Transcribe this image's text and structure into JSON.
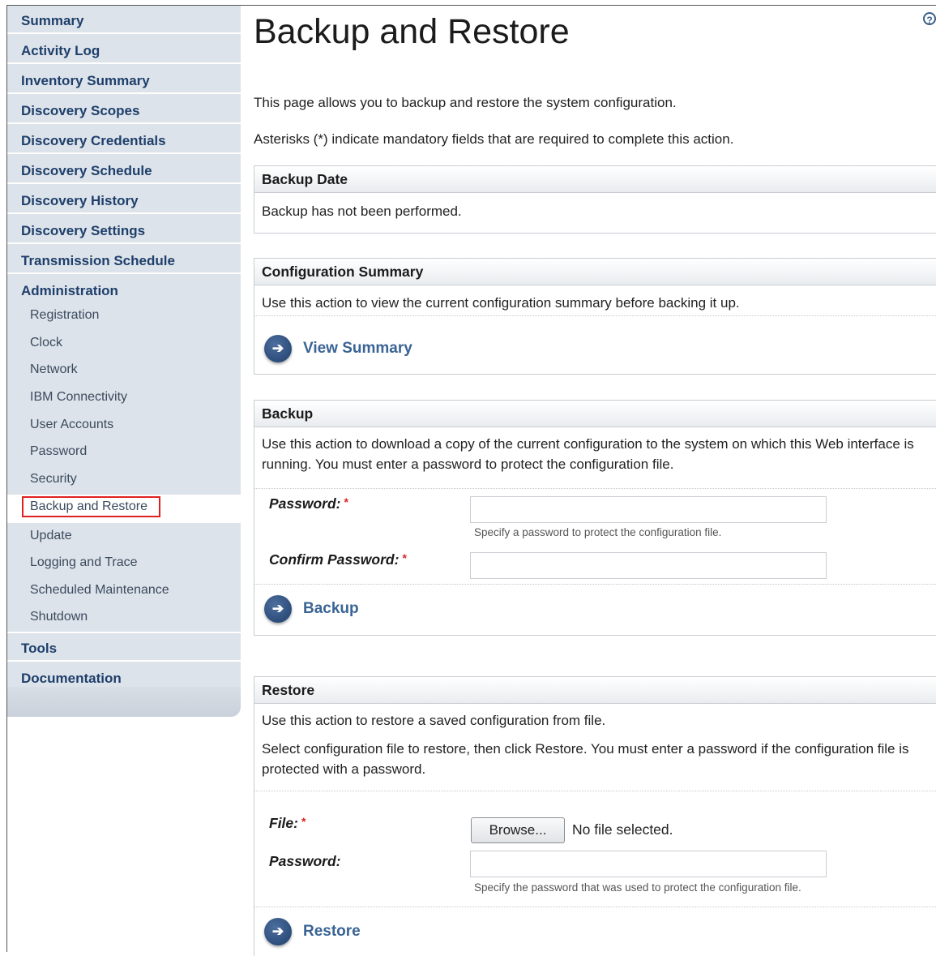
{
  "sidebar": {
    "top_items": [
      {
        "label": "Summary"
      },
      {
        "label": "Activity Log"
      },
      {
        "label": "Inventory Summary"
      },
      {
        "label": "Discovery Scopes"
      },
      {
        "label": "Discovery Credentials"
      },
      {
        "label": "Discovery Schedule"
      },
      {
        "label": "Discovery History"
      },
      {
        "label": "Discovery Settings"
      },
      {
        "label": "Transmission Schedule"
      },
      {
        "label": "Administration"
      }
    ],
    "admin_items": [
      {
        "label": "Registration"
      },
      {
        "label": "Clock"
      },
      {
        "label": "Network"
      },
      {
        "label": "IBM Connectivity"
      },
      {
        "label": "User Accounts"
      },
      {
        "label": "Password"
      },
      {
        "label": "Security"
      },
      {
        "label": "Backup and Restore",
        "selected": true
      },
      {
        "label": "Update"
      },
      {
        "label": "Logging and Trace"
      },
      {
        "label": "Scheduled Maintenance"
      },
      {
        "label": "Shutdown"
      }
    ],
    "bottom_items": [
      {
        "label": "Tools"
      },
      {
        "label": "Documentation"
      }
    ]
  },
  "page": {
    "title": "Backup and Restore",
    "help_icon": "?",
    "intro": "This page allows you to backup and restore the system configuration.",
    "mandatory_note": "Asterisks (*) indicate mandatory fields that are required to complete this action."
  },
  "backup_date": {
    "heading": "Backup Date",
    "text": "Backup has not been performed."
  },
  "config_summary": {
    "heading": "Configuration Summary",
    "text": "Use this action to view the current configuration summary before backing it up.",
    "action_label": "View Summary"
  },
  "backup": {
    "heading": "Backup",
    "text": "Use this action to download a copy of the current configuration to the system on which this Web interface is running. You must enter a password to protect the configuration file.",
    "password_label": "Password:",
    "password_hint": "Specify a password to protect the configuration file.",
    "confirm_label": "Confirm Password:",
    "required_mark": "*",
    "action_label": "Backup"
  },
  "restore": {
    "heading": "Restore",
    "text1": "Use this action to restore a saved configuration from file.",
    "text2": "Select configuration file to restore, then click Restore. You must enter a password if the configuration file is protected with a password.",
    "file_label": "File:",
    "required_mark": "*",
    "browse_label": "Browse...",
    "file_status": "No file selected.",
    "password_label": "Password:",
    "password_hint": "Specify the password that was used to protect the configuration file.",
    "action_label": "Restore"
  },
  "icons": {
    "action": "arrow-right-icon",
    "help": "help-icon"
  },
  "colors": {
    "nav_bg": "#dde3ea",
    "nav_text": "#1e3f6b",
    "action_text": "#3a6494",
    "selected_outline": "#e02020",
    "required": "#dd2222"
  }
}
